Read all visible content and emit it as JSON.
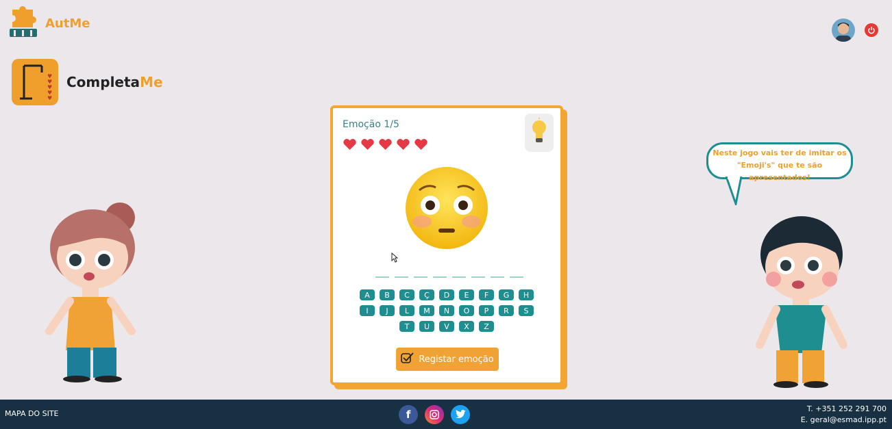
{
  "header": {
    "brand_name": "AutMe",
    "brand_color": "#ef9f2c"
  },
  "game": {
    "title_part1": "Completa",
    "title_part2": "Me"
  },
  "card": {
    "emotion_label": "Emoção 1/5",
    "lives": 5,
    "blank_count": 8,
    "keyboard_rows": [
      [
        "A",
        "B",
        "C",
        "Ç",
        "D",
        "E",
        "F",
        "G",
        "H"
      ],
      [
        "I",
        "J",
        "L",
        "M",
        "N",
        "O",
        "P",
        "R",
        "S"
      ],
      [
        "T",
        "U",
        "V",
        "X",
        "Z"
      ]
    ],
    "register_label": "Registar emoção",
    "emoji": "flushed-face"
  },
  "speech": {
    "line1": "Neste jogo vais ter de imitar os",
    "line2": "\"Emoji's\" que te são apresentados!"
  },
  "footer": {
    "sitemap": "MAPA DO SITE",
    "phone": "T. +351 252 291 700",
    "email": "E. geral@esmad.ipp.pt",
    "socials": [
      "facebook-icon",
      "instagram-icon",
      "twitter-icon"
    ]
  },
  "colors": {
    "accent": "#ef9f2c",
    "teal": "#1f8e90",
    "footer": "#173042",
    "background": "#ece7ea"
  }
}
